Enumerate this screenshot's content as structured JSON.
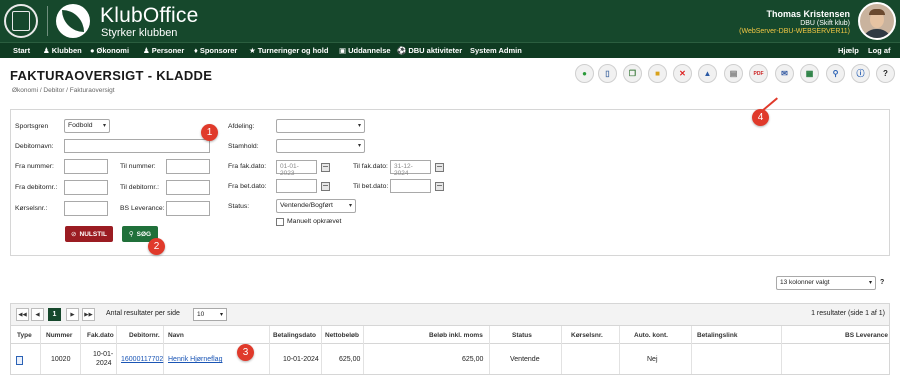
{
  "header": {
    "brand_title": "KlubOffice",
    "brand_subtitle": "Styrker klubben",
    "user_name": "Thomas Kristensen",
    "user_club": "DBU (Skift klub)",
    "user_server": "(WebServer-DBU-WEBSERVER11)"
  },
  "nav": {
    "items": [
      "Start",
      "Klubben",
      "Økonomi",
      "Personer",
      "Sponsorer",
      "Turneringer og hold",
      "Uddannelse",
      "DBU aktiviteter",
      "System Admin"
    ],
    "right": [
      "Hjælp",
      "Log af"
    ]
  },
  "page": {
    "title": "FAKTURAOVERSIGT - KLADDE",
    "breadcrumb": "Økonomi / Debitor / Fakturaoversigt"
  },
  "toolbar": {
    "icons": [
      "add-icon",
      "document-icon",
      "copy-icon",
      "folder-icon",
      "delete-icon",
      "bank-icon",
      "print-icon",
      "pdf-icon",
      "email-icon",
      "excel-icon",
      "search-icon",
      "help-icon",
      "question-icon"
    ]
  },
  "filters": {
    "sportsgren_label": "Sportsgren",
    "sportsgren_value": "Fodbold",
    "debitornavn_label": "Debitornavn:",
    "fra_nummer_label": "Fra nummer:",
    "til_nummer_label": "Til nummer:",
    "fra_debitornr_label": "Fra debitornr.:",
    "til_debitornr_label": "Til debitornr.:",
    "koerselsnr_label": "Kørselsnr.:",
    "bs_leverance_label": "BS Leverance:",
    "afdeling_label": "Afdeling:",
    "stamhold_label": "Stamhold:",
    "fra_fak_dato_label": "Fra fak.dato:",
    "fra_fak_dato_value": "01-01-2023",
    "til_fak_dato_label": "Til fak.dato:",
    "til_fak_dato_value": "31-12-2024",
    "fra_bet_dato_label": "Fra bet.dato:",
    "til_bet_dato_label": "Til bet.dato:",
    "status_label": "Status:",
    "status_value": "Ventende/Bogført",
    "manuelt_label": "Manuelt opkrævet",
    "reset_label": "NULSTIL",
    "search_label": "SØG"
  },
  "markers": [
    "1",
    "2",
    "3",
    "4"
  ],
  "columns_select": "13 kolonner valgt",
  "help_q": "?",
  "grid": {
    "pager_page": "1",
    "per_page_label": "Antal resultater per side",
    "per_page_value": "10",
    "result_count": "1 resultater (side 1 af 1)",
    "headers": [
      "Type",
      "Nummer",
      "Fak.dato",
      "Debitornr.",
      "Navn",
      "Betalingsdato",
      "Nettobeløb",
      "Beløb inkl. moms",
      "Status",
      "Kørselsnr.",
      "Auto. kont.",
      "Betalingslink",
      "BS Leverance"
    ],
    "row": {
      "nummer": "10020",
      "fak_dato_1": "10-01-",
      "fak_dato_2": "2024",
      "debitornr": "16000117702",
      "navn": "Henrik Hjørneflag",
      "betalingsdato": "10-01-2024",
      "nettobeloeb": "625,00",
      "beloeb_inkl_moms": "625,00",
      "status": "Ventende",
      "auto_kont": "Nej"
    }
  }
}
